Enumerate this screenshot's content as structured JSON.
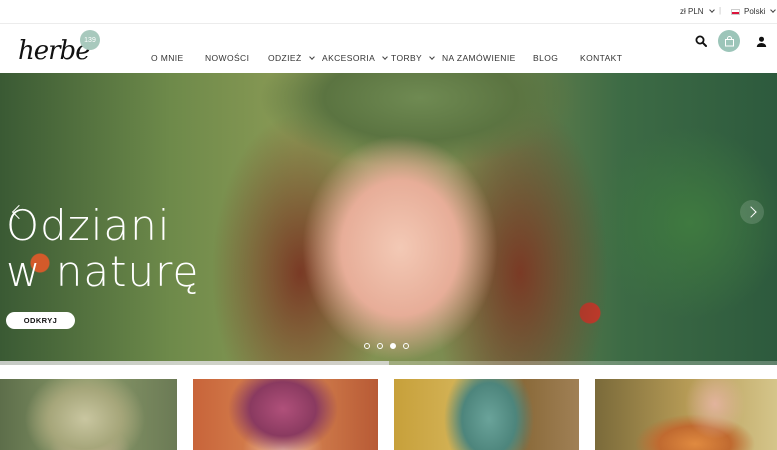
{
  "topbar": {
    "currency": "zł PLN",
    "separator": "|",
    "language": "Polski"
  },
  "header": {
    "logo_text": "herbe",
    "logo_badge": "139",
    "nav": [
      {
        "label": "O MNIE",
        "has_dropdown": false
      },
      {
        "label": "NOWOŚCI",
        "has_dropdown": false
      },
      {
        "label": "ODZIEŻ",
        "has_dropdown": true
      },
      {
        "label": "AKCESORIA",
        "has_dropdown": true
      },
      {
        "label": "TORBY",
        "has_dropdown": true
      },
      {
        "label": "NA ZAMÓWIENIE",
        "has_dropdown": false
      },
      {
        "label": "BLOG",
        "has_dropdown": false
      },
      {
        "label": "KONTAKT",
        "has_dropdown": false
      }
    ],
    "icons": [
      "search-icon",
      "cart-icon",
      "user-icon"
    ],
    "accent_color": "#9cc5b9"
  },
  "hero": {
    "title_line1": "Odziani",
    "title_line2": "w naturę",
    "button_label": "ODKRYJ",
    "slide_count": 4,
    "active_slide": 3
  },
  "tiles": [
    "category-tile-1",
    "category-tile-2",
    "category-tile-3",
    "category-tile-4"
  ]
}
